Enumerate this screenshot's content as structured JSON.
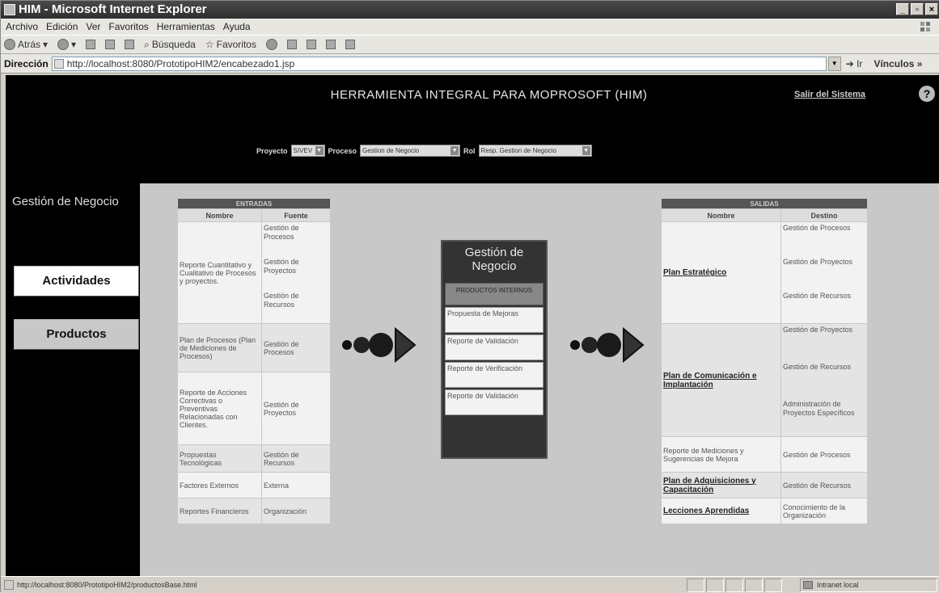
{
  "window": {
    "title": "HIM - Microsoft Internet Explorer",
    "controls": [
      "_",
      "▫",
      "×"
    ]
  },
  "menu": [
    "Archivo",
    "Edición",
    "Ver",
    "Favoritos",
    "Herramientas",
    "Ayuda"
  ],
  "toolbar": {
    "back": "Atrás",
    "search": "Búsqueda",
    "favorites": "Favoritos"
  },
  "address": {
    "label": "Dirección",
    "url": "http://localhost:8080/PrototipoHIM2/encabezado1.jsp",
    "go": "Ir",
    "links": "Vínculos »"
  },
  "header": {
    "title": "HERRAMIENTA INTEGRAL PARA MOPROSOFT (HIM)",
    "logout": "Salir del Sistema",
    "help": "?"
  },
  "selectors": {
    "project_label": "Proyecto",
    "project_value": "SIVEV",
    "process_label": "Proceso",
    "process_value": "Gestion de Negocio",
    "role_label": "Rol",
    "role_value": "Resp. Gestion de Negocio"
  },
  "sidebar": {
    "title": "Gestión de Negocio",
    "activities": "Actividades",
    "products": "Productos"
  },
  "inputs": {
    "title": "ENTRADAS",
    "col_name": "Nombre",
    "col_source": "Fuente",
    "rows": [
      {
        "name": "Reporte Cuantitativo y Cualitativo de Procesos y proyectos.",
        "sources": [
          "Gestión de Procesos",
          "Gestión de Proyectos",
          "Gestión de Recursos"
        ]
      },
      {
        "name": "Plan de Procesos (Plan de Mediciones de Procesos)",
        "sources": [
          "Gestión de Procesos"
        ]
      },
      {
        "name": "Reporte de Acciones Correctivas o Preventivas Relacionadas con Clientes.",
        "sources": [
          "Gestión de Proyectos"
        ]
      },
      {
        "name": "Propuestas Tecnológicas",
        "sources": [
          "Gestión de Recursos"
        ]
      },
      {
        "name": "Factores Externos",
        "sources": [
          "Externa"
        ]
      },
      {
        "name": "Reportes Financieros",
        "sources": [
          "Organización"
        ]
      }
    ]
  },
  "center": {
    "title": "Gestión de Negocio",
    "subtitle": "PRODUCTOS INTERNOS",
    "items": [
      "Propuesta de Mejoras",
      "Reporte de Validación",
      "Reporte de Verificación",
      "Reporte de Validación"
    ]
  },
  "outputs": {
    "title": "SALIDAS",
    "col_name": "Nombre",
    "col_dest": "Destino",
    "rows": [
      {
        "name": "Plan Estratégico",
        "link": true,
        "dests": [
          "Gestión de Procesos",
          "Gestión de Proyectos",
          "Gestión de Recursos"
        ]
      },
      {
        "name": "Plan de Comunicación e Implantación",
        "link": true,
        "dests": [
          "Gestión de Proyectos",
          "Gestión de Recursos",
          "Administración de Proyectos Específicos"
        ]
      },
      {
        "name": "Reporte de Mediciones y Sugerencias de Mejora",
        "link": false,
        "dests": [
          "Gestión de Procesos"
        ]
      },
      {
        "name": "Plan de Adquisiciones y Capacitación",
        "link": true,
        "dests": [
          "Gestión de Recursos"
        ]
      },
      {
        "name": "Lecciones Aprendidas",
        "link": true,
        "dests": [
          "Conocimiento de la Organización"
        ]
      }
    ]
  },
  "status": {
    "url": "http://localhost:8080/PrototipoHIM2/productosBase.html",
    "zone": "Intranet local"
  }
}
